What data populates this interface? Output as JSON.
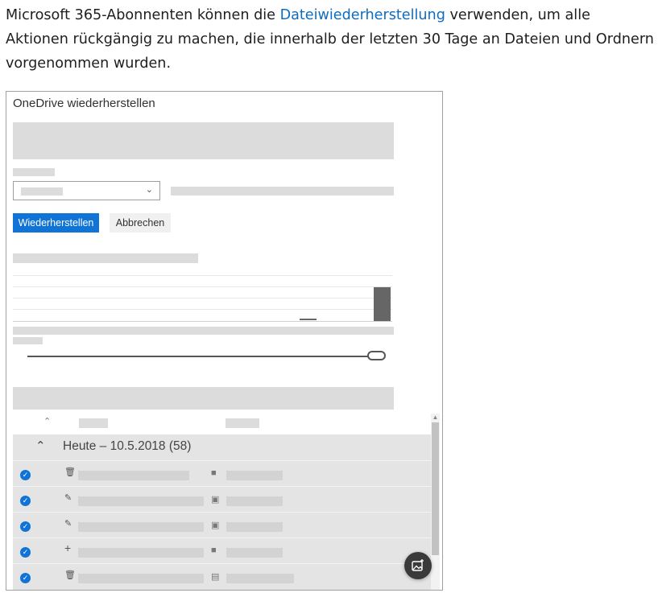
{
  "intro": {
    "text_before": "Microsoft 365-Abonnenten können die ",
    "link": "Dateiwiederherstellung",
    "text_after": " verwenden, um alle Aktionen rückgängig zu machen, die innerhalb der letzten 30 Tage an Dateien und Ordnern vorgenommen wurden."
  },
  "window": {
    "title": "OneDrive wiederherstellen",
    "restore_button": "Wiederherstellen",
    "cancel_button": "Abbrechen"
  },
  "file_list": {
    "group_label": "Heute – 10.5.2018 (58)",
    "rows": [
      {
        "selected": true,
        "action_icon": "delete-icon",
        "type_icon": "folder-icon"
      },
      {
        "selected": true,
        "action_icon": "edit-icon",
        "type_icon": "image-icon"
      },
      {
        "selected": true,
        "action_icon": "edit-icon",
        "type_icon": "image-icon"
      },
      {
        "selected": true,
        "action_icon": "add-icon",
        "type_icon": "folder-icon"
      },
      {
        "selected": true,
        "action_icon": "delete-icon",
        "type_icon": "document-icon"
      }
    ]
  },
  "floating_button": {
    "icon": "image-sparkle-icon"
  },
  "colors": {
    "link": "#0f6cbd",
    "primary": "#0f74d6",
    "placeholder": "#dcdcdc"
  }
}
